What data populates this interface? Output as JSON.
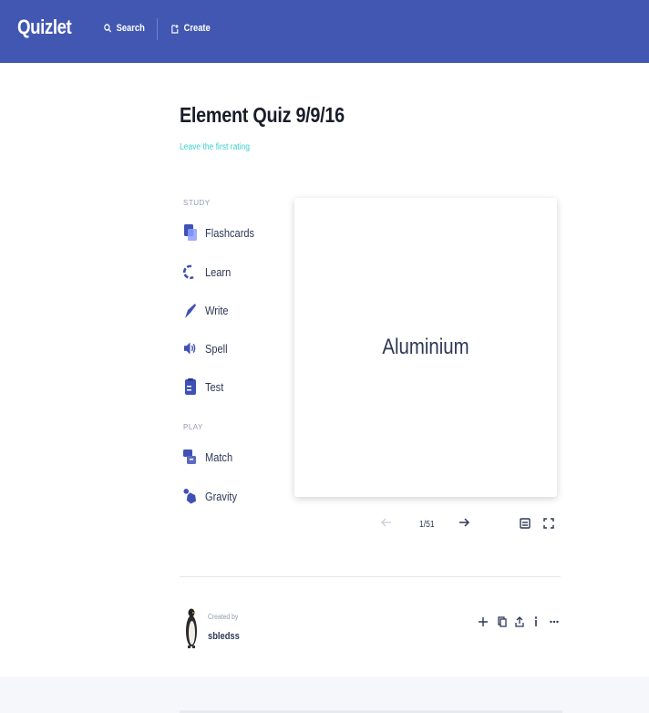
{
  "header": {
    "logo": "Quizlet",
    "search_label": "Search",
    "create_label": "Create"
  },
  "set": {
    "title": "Element Quiz 9/9/16",
    "rating_link": "Leave the first rating"
  },
  "study": {
    "section_label": "STUDY",
    "modes": [
      {
        "label": "Flashcards",
        "icon": "flashcards-icon"
      },
      {
        "label": "Learn",
        "icon": "learn-icon"
      },
      {
        "label": "Write",
        "icon": "write-icon"
      },
      {
        "label": "Spell",
        "icon": "spell-icon"
      },
      {
        "label": "Test",
        "icon": "test-icon"
      }
    ]
  },
  "play": {
    "section_label": "PLAY",
    "modes": [
      {
        "label": "Match",
        "icon": "match-icon"
      },
      {
        "label": "Gravity",
        "icon": "gravity-icon"
      }
    ]
  },
  "flashcard": {
    "term": "Aluminium",
    "counter": "1/51"
  },
  "creator": {
    "caption": "Created by",
    "username": "sbledss"
  },
  "colors": {
    "brand": "#4257b2",
    "accent": "#3ccfcf",
    "icon": "#3f51b5"
  }
}
